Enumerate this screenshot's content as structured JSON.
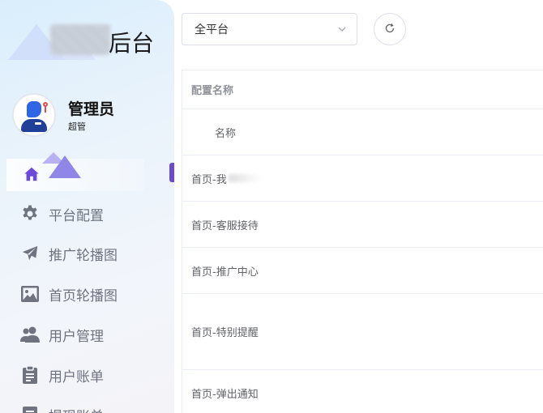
{
  "sidebar": {
    "brand_title": "后台",
    "user": {
      "name": "管理员",
      "role": "超管"
    },
    "items": [
      {
        "label": "",
        "icon": "home-icon",
        "active": true
      },
      {
        "label": "平台配置",
        "icon": "gear-icon"
      },
      {
        "label": "推广轮播图",
        "icon": "paper-plane-icon"
      },
      {
        "label": "首页轮播图",
        "icon": "image-icon"
      },
      {
        "label": "用户管理",
        "icon": "users-icon"
      },
      {
        "label": "用户账单",
        "icon": "clipboard-icon"
      },
      {
        "label": "提现账单",
        "icon": "document-icon"
      }
    ],
    "colors": {
      "active_accent": "#6c4ad9",
      "home_icon": "#6c4ad9",
      "icon_gray": "#6f7380"
    }
  },
  "toolbar": {
    "platform_select": {
      "value": "全平台"
    },
    "refresh_icon": "refresh-icon"
  },
  "table": {
    "header": "配置名称",
    "rows": [
      {
        "name": "名称"
      },
      {
        "name": "首页-我"
      },
      {
        "name": "首页-客服接待"
      },
      {
        "name": "首页-推广中心"
      },
      {
        "name": "首页-特别提醒"
      },
      {
        "name": "首页-弹出通知"
      }
    ]
  }
}
